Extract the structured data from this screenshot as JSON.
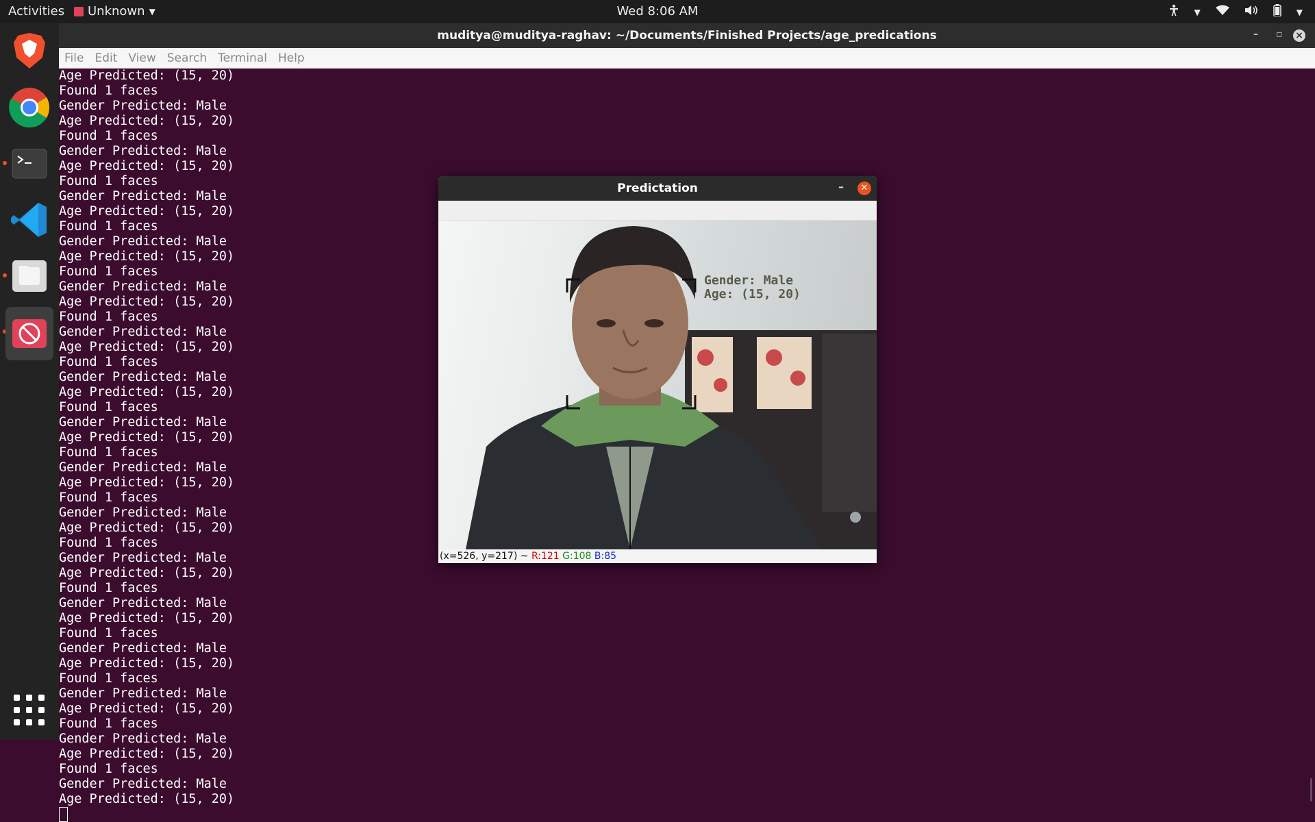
{
  "topbar": {
    "activities": "Activities",
    "app_name": "Unknown",
    "clock": "Wed  8:06 AM",
    "tray_icons": [
      "accessibility-icon",
      "network-icon",
      "volume-icon",
      "battery-icon",
      "chevron-down-icon"
    ]
  },
  "dock": {
    "apps": [
      "brave-browser",
      "chrome",
      "terminal",
      "vscode",
      "files",
      "no-entry-app"
    ],
    "show_apps_label": "show-applications"
  },
  "terminal": {
    "title": "muditya@muditya-raghav: ~/Documents/Finished Projects/age_predications",
    "menu": [
      "File",
      "Edit",
      "View",
      "Search",
      "Terminal",
      "Help"
    ],
    "lines": [
      "Age Predicted: (15, 20)",
      "Found 1 faces",
      "Gender Predicted: Male",
      "Age Predicted: (15, 20)",
      "Found 1 faces",
      "Gender Predicted: Male",
      "Age Predicted: (15, 20)",
      "Found 1 faces",
      "Gender Predicted: Male",
      "Age Predicted: (15, 20)",
      "Found 1 faces",
      "Gender Predicted: Male",
      "Age Predicted: (15, 20)",
      "Found 1 faces",
      "Gender Predicted: Male",
      "Age Predicted: (15, 20)",
      "Found 1 faces",
      "Gender Predicted: Male",
      "Age Predicted: (15, 20)",
      "Found 1 faces",
      "Gender Predicted: Male",
      "Age Predicted: (15, 20)",
      "Found 1 faces",
      "Gender Predicted: Male",
      "Age Predicted: (15, 20)",
      "Found 1 faces",
      "Gender Predicted: Male",
      "Age Predicted: (15, 20)",
      "Found 1 faces",
      "Gender Predicted: Male",
      "Age Predicted: (15, 20)",
      "Found 1 faces",
      "Gender Predicted: Male",
      "Age Predicted: (15, 20)",
      "Found 1 faces",
      "Gender Predicted: Male",
      "Age Predicted: (15, 20)",
      "Found 1 faces",
      "Gender Predicted: Male",
      "Age Predicted: (15, 20)",
      "Found 1 faces",
      "Gender Predicted: Male",
      "Age Predicted: (15, 20)",
      "Found 1 faces",
      "Gender Predicted: Male",
      "Age Predicted: (15, 20)",
      "Found 1 faces",
      "Gender Predicted: Male",
      "Age Predicted: (15, 20)"
    ]
  },
  "prediction_window": {
    "title": "Predictation",
    "overlay_gender": "Gender: Male",
    "overlay_age": "Age: (15, 20)",
    "status_coords": "(x=526, y=217) ~",
    "status_r": "R:121",
    "status_g": "G:108",
    "status_b": "B:85"
  }
}
